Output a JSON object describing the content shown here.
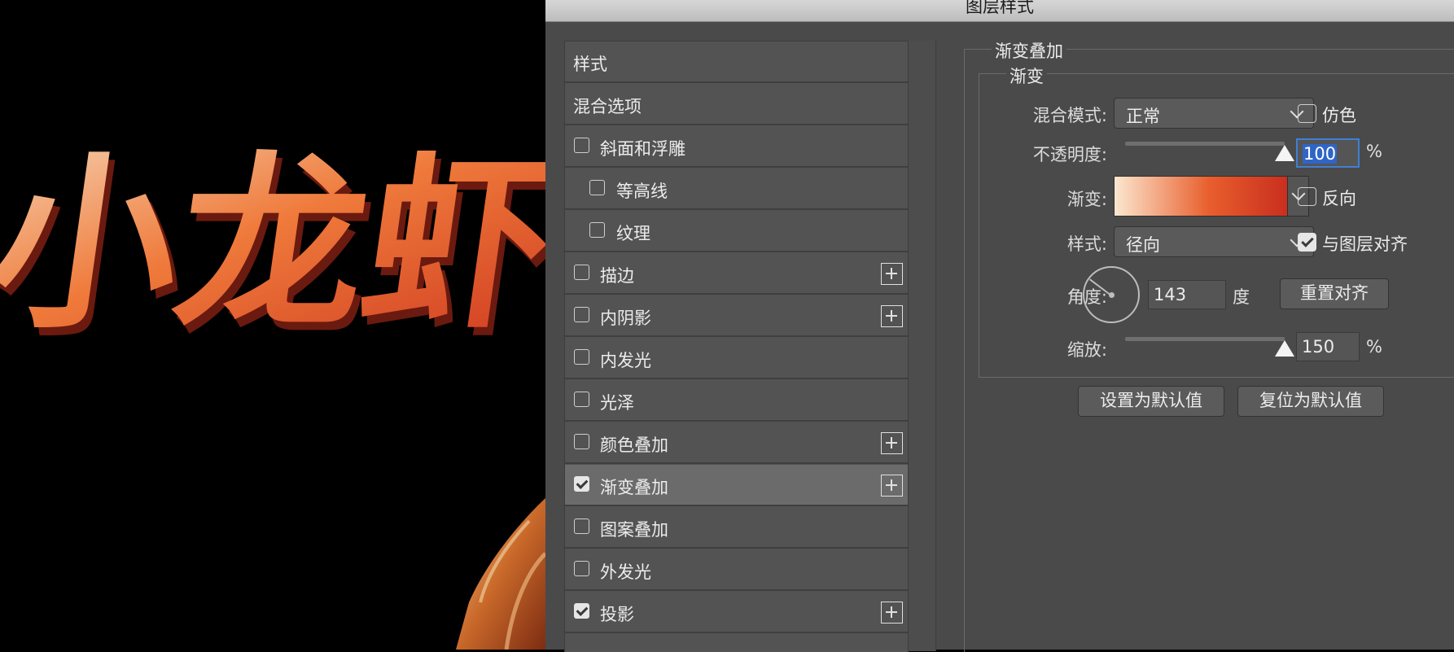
{
  "canvas": {
    "artwork_text": "小龙虾"
  },
  "dialog": {
    "title": "图层样式"
  },
  "styles_list": {
    "items": [
      {
        "label": "样式",
        "checkbox": false,
        "checked": false,
        "plus": false,
        "indent": false,
        "selected": false
      },
      {
        "label": "混合选项",
        "checkbox": false,
        "checked": false,
        "plus": false,
        "indent": false,
        "selected": false
      },
      {
        "label": "斜面和浮雕",
        "checkbox": true,
        "checked": false,
        "plus": false,
        "indent": false,
        "selected": false
      },
      {
        "label": "等高线",
        "checkbox": true,
        "checked": false,
        "plus": false,
        "indent": true,
        "selected": false
      },
      {
        "label": "纹理",
        "checkbox": true,
        "checked": false,
        "plus": false,
        "indent": true,
        "selected": false
      },
      {
        "label": "描边",
        "checkbox": true,
        "checked": false,
        "plus": true,
        "indent": false,
        "selected": false
      },
      {
        "label": "内阴影",
        "checkbox": true,
        "checked": false,
        "plus": true,
        "indent": false,
        "selected": false
      },
      {
        "label": "内发光",
        "checkbox": true,
        "checked": false,
        "plus": false,
        "indent": false,
        "selected": false
      },
      {
        "label": "光泽",
        "checkbox": true,
        "checked": false,
        "plus": false,
        "indent": false,
        "selected": false
      },
      {
        "label": "颜色叠加",
        "checkbox": true,
        "checked": false,
        "plus": true,
        "indent": false,
        "selected": false
      },
      {
        "label": "渐变叠加",
        "checkbox": true,
        "checked": true,
        "plus": true,
        "indent": false,
        "selected": true
      },
      {
        "label": "图案叠加",
        "checkbox": true,
        "checked": false,
        "plus": false,
        "indent": false,
        "selected": false
      },
      {
        "label": "外发光",
        "checkbox": true,
        "checked": false,
        "plus": false,
        "indent": false,
        "selected": false
      },
      {
        "label": "投影",
        "checkbox": true,
        "checked": true,
        "plus": true,
        "indent": false,
        "selected": false
      }
    ]
  },
  "gradient_overlay": {
    "section_title": "渐变叠加",
    "group_title": "渐变",
    "blend_mode": {
      "label": "混合模式:",
      "value": "正常"
    },
    "dither": {
      "label": "仿色",
      "checked": false
    },
    "opacity": {
      "label": "不透明度:",
      "value": "100",
      "unit": "%",
      "level": 1.0
    },
    "gradient": {
      "label": "渐变:",
      "colors": [
        "#fbe7cf",
        "#e85e2c",
        "#c92f1f"
      ]
    },
    "reverse": {
      "label": "反向",
      "checked": false
    },
    "style": {
      "label": "样式:",
      "value": "径向"
    },
    "align_with_layer": {
      "label": "与图层对齐",
      "checked": true
    },
    "angle": {
      "label": "角度:",
      "value": "143",
      "unit": "度"
    },
    "reset_alignment_button": "重置对齐",
    "scale": {
      "label": "缩放:",
      "value": "150",
      "unit": "%",
      "level": 1.0
    },
    "set_default_button": "设置为默认值",
    "reset_default_button": "复位为默认值"
  }
}
